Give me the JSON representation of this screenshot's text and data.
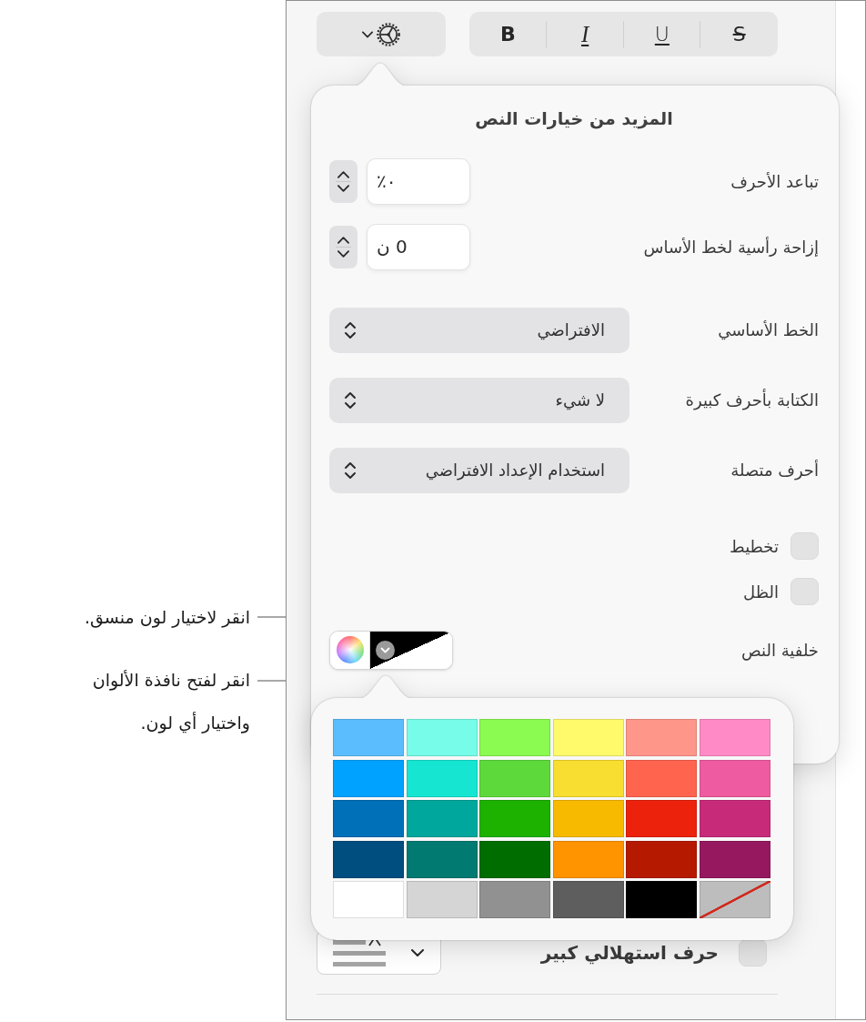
{
  "callouts": [
    {
      "text": "انقر لاختيار لون منسق."
    },
    {
      "text": "انقر لفتح نافذة الألوان\nواختيار أي لون."
    }
  ],
  "toolbar": {
    "style_buttons": [
      {
        "kind": "strikethrough",
        "label": "S"
      },
      {
        "kind": "underline",
        "label": "U"
      },
      {
        "kind": "italic",
        "label": "I"
      },
      {
        "kind": "bold",
        "label": "B"
      }
    ]
  },
  "popover": {
    "title": "المزيد من خيارات النص",
    "rows": [
      {
        "kind": "stepper",
        "label": "تباعد الأحرف",
        "value": "٠٪"
      },
      {
        "kind": "stepper",
        "label": "إزاحة رأسية لخط الأساس",
        "value": "0 ن"
      },
      {
        "kind": "popup",
        "label": "الخط الأساسي",
        "value": "الافتراضي"
      },
      {
        "kind": "popup",
        "label": "الكتابة بأحرف كبيرة",
        "value": "لا شيء"
      },
      {
        "kind": "popup",
        "label": "أحرف متصلة",
        "value": "استخدام الإعداد الافتراضي"
      },
      {
        "kind": "checkbox",
        "label": "تخطيط",
        "checked": false
      },
      {
        "kind": "checkbox",
        "label": "الظل",
        "checked": false
      },
      {
        "kind": "color_well",
        "label": "خلفية النص",
        "color": "#000000"
      }
    ]
  },
  "palette": {
    "swatches": [
      {
        "kind": "solid",
        "color": "#5bbdfe"
      },
      {
        "kind": "solid",
        "color": "#77fce9"
      },
      {
        "kind": "solid",
        "color": "#8bfa51"
      },
      {
        "kind": "solid",
        "color": "#fffa6b"
      },
      {
        "kind": "solid",
        "color": "#ff968a"
      },
      {
        "kind": "solid",
        "color": "#ff8ac6"
      },
      {
        "kind": "solid",
        "color": "#00a2ff"
      },
      {
        "kind": "solid",
        "color": "#16e6d1"
      },
      {
        "kind": "solid",
        "color": "#5ed93c"
      },
      {
        "kind": "solid",
        "color": "#f8de30"
      },
      {
        "kind": "solid",
        "color": "#ff644f"
      },
      {
        "kind": "solid",
        "color": "#ef5ba0"
      },
      {
        "kind": "solid",
        "color": "#0070b8"
      },
      {
        "kind": "solid",
        "color": "#00a79d"
      },
      {
        "kind": "solid",
        "color": "#1db100"
      },
      {
        "kind": "solid",
        "color": "#f7ba00"
      },
      {
        "kind": "solid",
        "color": "#ed220d"
      },
      {
        "kind": "solid",
        "color": "#c82a7a"
      },
      {
        "kind": "solid",
        "color": "#004d80"
      },
      {
        "kind": "solid",
        "color": "#017a72"
      },
      {
        "kind": "solid",
        "color": "#006d00"
      },
      {
        "kind": "solid",
        "color": "#ff9300"
      },
      {
        "kind": "solid",
        "color": "#b51a00"
      },
      {
        "kind": "solid",
        "color": "#961960"
      },
      {
        "kind": "solid",
        "color": "#ffffff"
      },
      {
        "kind": "solid",
        "color": "#d5d5d5"
      },
      {
        "kind": "solid",
        "color": "#919191"
      },
      {
        "kind": "solid",
        "color": "#5e5e5e"
      },
      {
        "kind": "solid",
        "color": "#000000"
      },
      {
        "kind": "none",
        "color": "#bdbdbd"
      }
    ]
  },
  "drop_cap": {
    "label": "حرف استهلالي كبير",
    "checked": false
  }
}
